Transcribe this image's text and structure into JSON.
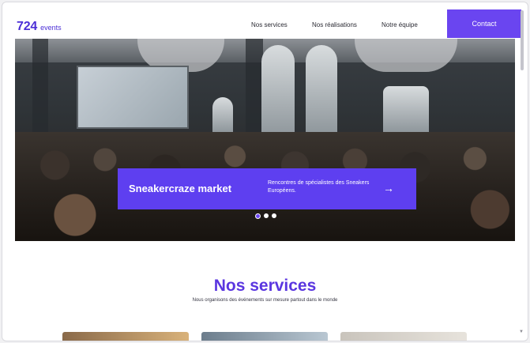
{
  "header": {
    "logo_number": "724",
    "logo_word": "events",
    "nav": [
      "Nos services",
      "Nos réalisations",
      "Notre équipe"
    ],
    "contact_label": "Contact"
  },
  "hero": {
    "banner_title": "Sneakercraze market",
    "banner_description": "Rencontres de spécialistes des Sneakers Européens.",
    "arrow_icon": "arrow-right-icon",
    "slides": 3,
    "active_slide": 1
  },
  "services": {
    "title": "Nos services",
    "subtitle": "Nous organisons des événements sur mesure partout dans le monde"
  },
  "colors": {
    "accent": "#6a45f0",
    "banner": "#5e3ff0",
    "title": "#5a36e0"
  }
}
